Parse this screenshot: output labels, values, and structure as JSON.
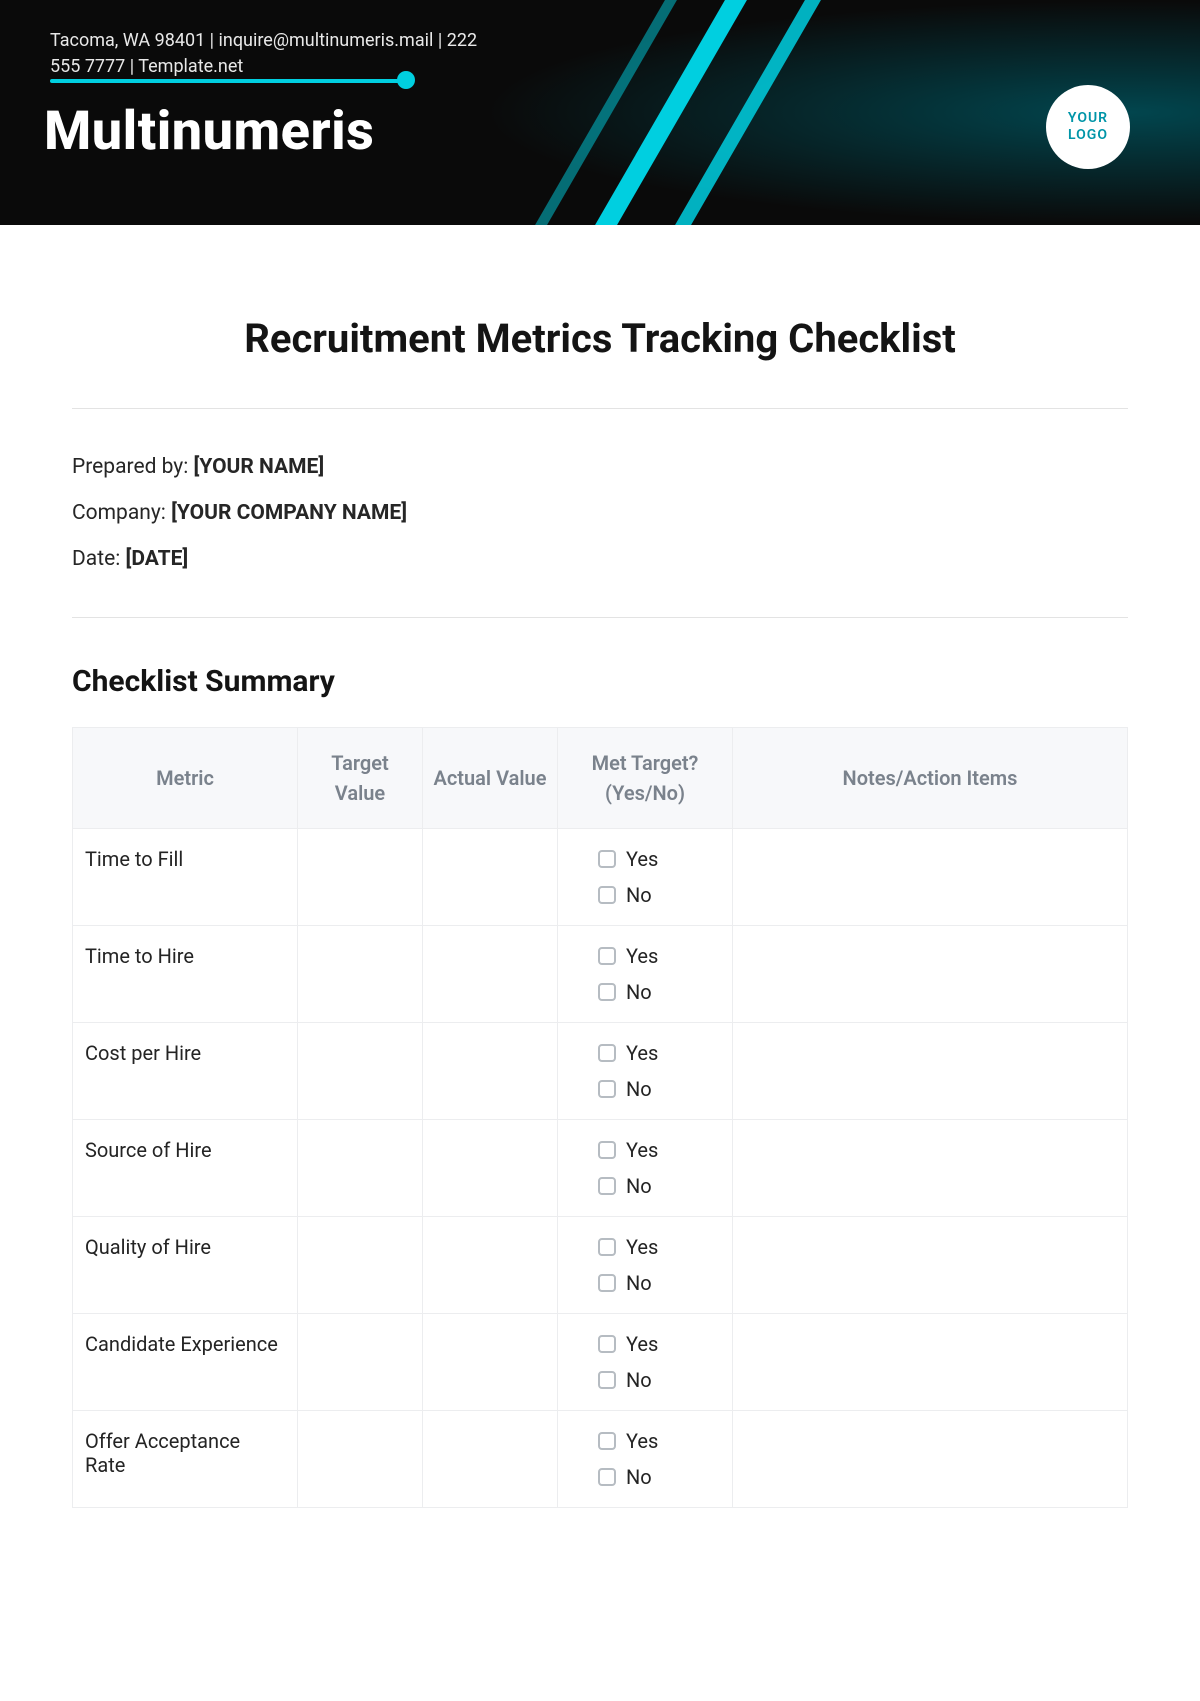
{
  "header": {
    "meta": "Tacoma, WA 98401 | inquire@multinumeris.mail | 222 555 7777 | Template.net",
    "brand": "Multinumeris",
    "logo_text": "YOUR LOGO"
  },
  "title": "Recruitment Metrics Tracking Checklist",
  "fields": {
    "prepared_by_label": "Prepared by: ",
    "prepared_by_value": "[YOUR NAME]",
    "company_label": "Company: ",
    "company_value": "[YOUR COMPANY NAME]",
    "date_label": "Date: ",
    "date_value": "[DATE]"
  },
  "section": {
    "summary_title": "Checklist Summary"
  },
  "table": {
    "headers": {
      "metric": "Metric",
      "target": "Target Value",
      "actual": "Actual Value",
      "met": "Met Target? (Yes/No)",
      "notes": "Notes/Action Items"
    },
    "yes": "Yes",
    "no": "No",
    "rows": [
      {
        "metric": "Time to Fill"
      },
      {
        "metric": "Time to Hire"
      },
      {
        "metric": "Cost per Hire"
      },
      {
        "metric": "Source of Hire"
      },
      {
        "metric": "Quality of Hire"
      },
      {
        "metric": "Candidate Experience"
      },
      {
        "metric": "Offer Acceptance Rate"
      }
    ]
  }
}
